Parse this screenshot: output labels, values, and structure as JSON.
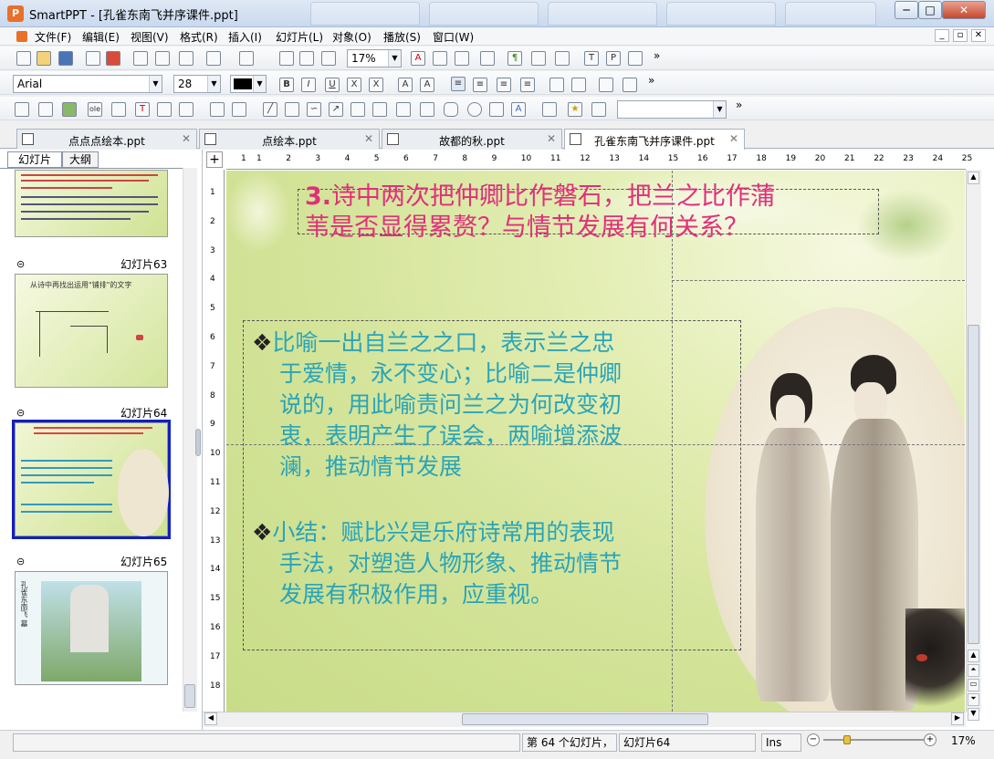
{
  "window": {
    "app_name": "SmartPPT",
    "title": "SmartPPT - [孔雀东南飞并序课件.ppt]",
    "minimize": "─",
    "maximize": "□",
    "close": "✕"
  },
  "menu": {
    "items": [
      "文件(F)",
      "编辑(E)",
      "视图(V)",
      "格式(R)",
      "插入(I)",
      "幻灯片(L)",
      "对象(O)",
      "播放(S)",
      "窗口(W)"
    ],
    "mdi_min": "_",
    "mdi_restore": "▫",
    "mdi_close": "✕"
  },
  "toolbar": {
    "zoom": "17%",
    "font_name": "Arial",
    "font_size": "28",
    "more": "»"
  },
  "tabs": [
    {
      "label": "点点点绘本.ppt",
      "close": "✕"
    },
    {
      "label": "点绘本.ppt",
      "close": "✕"
    },
    {
      "label": "故都的秋.ppt",
      "close": "✕"
    },
    {
      "label": "孔雀东南飞并序课件.ppt",
      "close": "✕"
    }
  ],
  "panel": {
    "tab_slides": "幻灯片",
    "tab_outline": "大纲",
    "slides": [
      {
        "label": "幻灯片63"
      },
      {
        "label": "幻灯片64"
      },
      {
        "label": "幻灯片65"
      }
    ],
    "thumb63_title": "从诗中再找出运用\"铺排\"的文字",
    "thumb65_text": "孔雀东南飞 墓"
  },
  "ruler": {
    "top": [
      "1",
      "1",
      "2",
      "3",
      "4",
      "5",
      "6",
      "7",
      "8",
      "9",
      "10",
      "11",
      "12",
      "13",
      "14",
      "15",
      "16",
      "17",
      "18",
      "19",
      "20",
      "21",
      "22",
      "23",
      "24",
      "25"
    ],
    "left": [
      "1",
      "2",
      "3",
      "4",
      "5",
      "6",
      "7",
      "8",
      "9",
      "10",
      "11",
      "12",
      "13",
      "14",
      "15",
      "16",
      "17",
      "18"
    ]
  },
  "slide": {
    "title_num": "3.",
    "title_line1": "诗中两次把仲卿比作磐石，把兰之比作蒲",
    "title_line2": "苇是否显得累赘？与情节发展有何关系？",
    "bullet": "❖",
    "body1": [
      "比喻一出自兰之之口，表示兰之忠",
      "于爱情，永不变心；比喻二是仲卿",
      "说的，用此喻责问兰之为何改变初",
      "衷，表明产生了误会，两喻增添波",
      "澜，推动情节发展"
    ],
    "body2": [
      "小结：赋比兴是乐府诗常用的表现",
      "手法，对塑造人物形象、推动情节",
      "发展有积极作用，应重视。"
    ]
  },
  "status": {
    "slide_info": "第 64 个幻灯片，",
    "slide_name": "幻灯片64",
    "mode": "Ins",
    "zoom": "17%"
  },
  "colors": {
    "title": "#e0307a",
    "body": "#2aa4b8",
    "selection": "#1020c0"
  }
}
